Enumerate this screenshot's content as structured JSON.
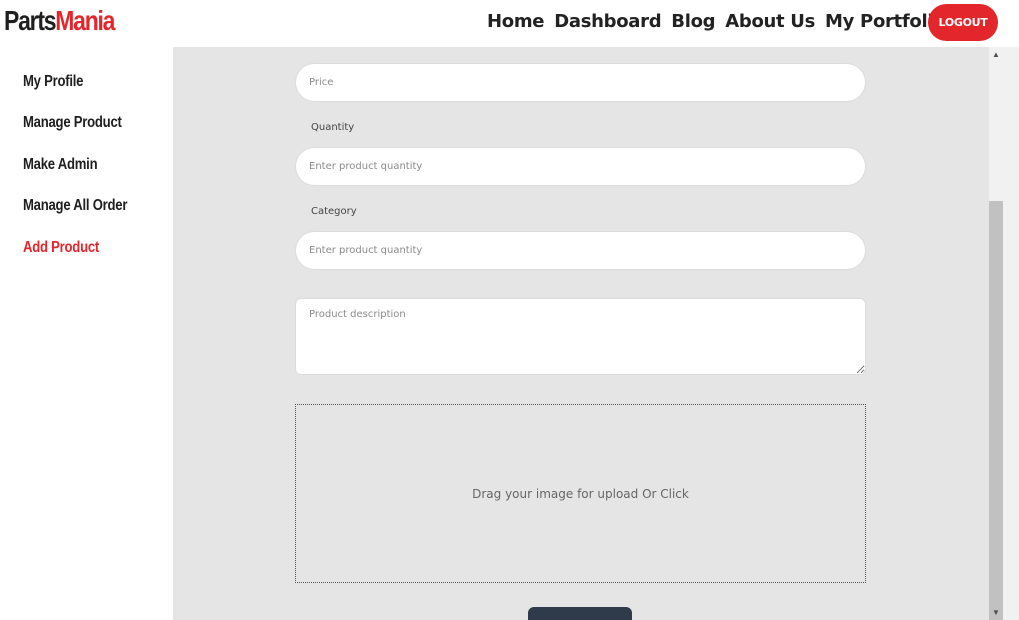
{
  "brand": {
    "part1": "Parts",
    "part2": "Mania"
  },
  "nav": {
    "links": [
      "Home",
      "Dashboard",
      "Blog",
      "About Us",
      "My Portfolio"
    ],
    "logout_label": "LOGOUT"
  },
  "sidebar": {
    "items": [
      {
        "label": "My Profile",
        "active": false
      },
      {
        "label": "Manage Product",
        "active": false
      },
      {
        "label": "Make Admin",
        "active": false
      },
      {
        "label": "Manage All Order",
        "active": false
      },
      {
        "label": "Add Product",
        "active": true
      }
    ]
  },
  "form": {
    "price_placeholder": "Price",
    "quantity_label": "Quantity",
    "quantity_placeholder": "Enter product quantity",
    "category_label": "Category",
    "category_placeholder": "Enter product quantity",
    "description_placeholder": "Product description",
    "dropzone_text": "Drag your image for upload Or Click"
  },
  "colors": {
    "accent": "#e3262c",
    "panel": "#e5e5e5",
    "submit": "#2f3a4a"
  }
}
